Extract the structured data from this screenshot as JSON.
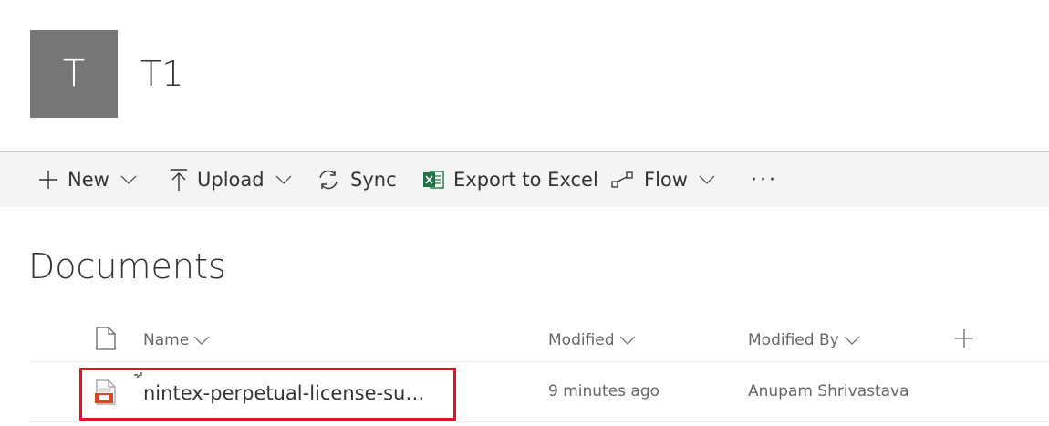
{
  "site": {
    "logo_letter": "T",
    "title": "T1"
  },
  "toolbar": {
    "new_label": "New",
    "upload_label": "Upload",
    "sync_label": "Sync",
    "export_label": "Export to Excel",
    "flow_label": "Flow",
    "more_label": "···"
  },
  "library": {
    "title": "Documents",
    "columns": {
      "name": "Name",
      "modified": "Modified",
      "modified_by": "Modified By"
    },
    "rows": [
      {
        "name": "nintex-perpetual-license-suppo...",
        "modified": "9 minutes ago",
        "modified_by": "Anupam Shrivastava"
      }
    ]
  },
  "colors": {
    "logo_bg": "#767676",
    "excel_green": "#217346",
    "highlight_red": "#e81123",
    "file_icon_orange": "#d24726"
  }
}
